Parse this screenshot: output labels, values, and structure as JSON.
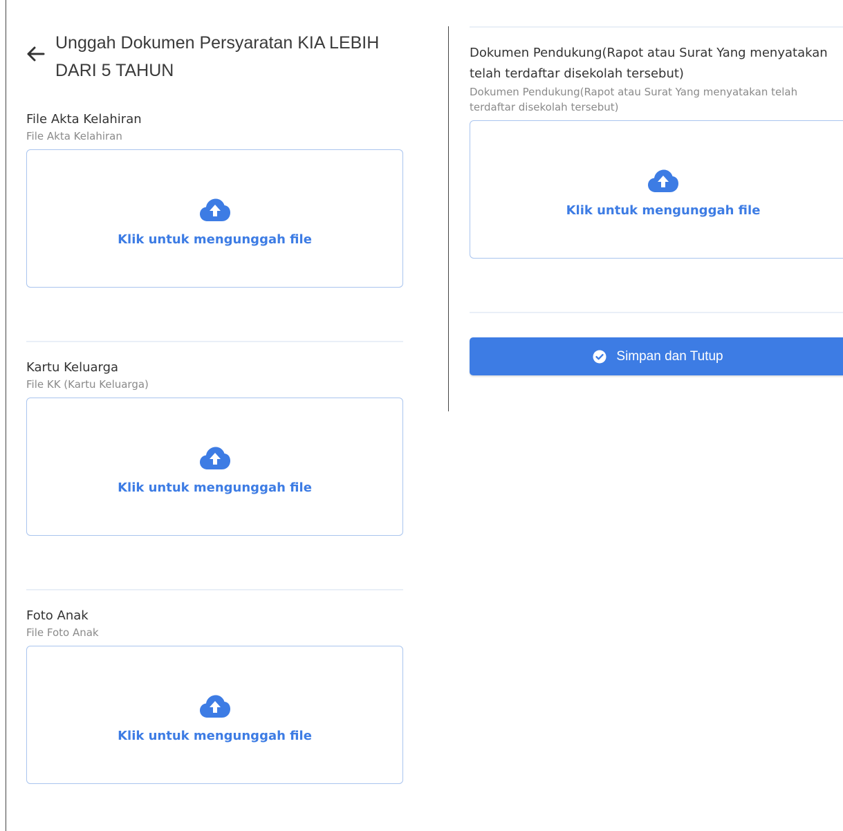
{
  "header": {
    "title": "Unggah Dokumen Persyaratan KIA LEBIH DARI 5 TAHUN",
    "back_icon": "arrow-left-icon"
  },
  "upload_text": "Klik untuk mengunggah file",
  "fields": {
    "akta": {
      "label": "File Akta Kelahiran",
      "hint": "File Akta Kelahiran"
    },
    "kk": {
      "label": "Kartu Keluarga",
      "hint": "File KK (Kartu Keluarga)"
    },
    "foto": {
      "label": "Foto Anak",
      "hint": "File Foto Anak"
    },
    "pendukung": {
      "label": "Dokumen Pendukung(Rapot atau Surat Yang menyatakan telah terdaftar disekolah tersebut)",
      "hint": "Dokumen Pendukung(Rapot atau Surat Yang menyatakan telah terdaftar disekolah tersebut)"
    }
  },
  "save_button": {
    "label": "Simpan dan Tutup",
    "icon": "check-circle-icon"
  },
  "colors": {
    "accent": "#3d7ce4",
    "dropzone_border": "#a9c4ee",
    "hint_text": "#8a8a8a",
    "divider": "#e9eff7"
  }
}
